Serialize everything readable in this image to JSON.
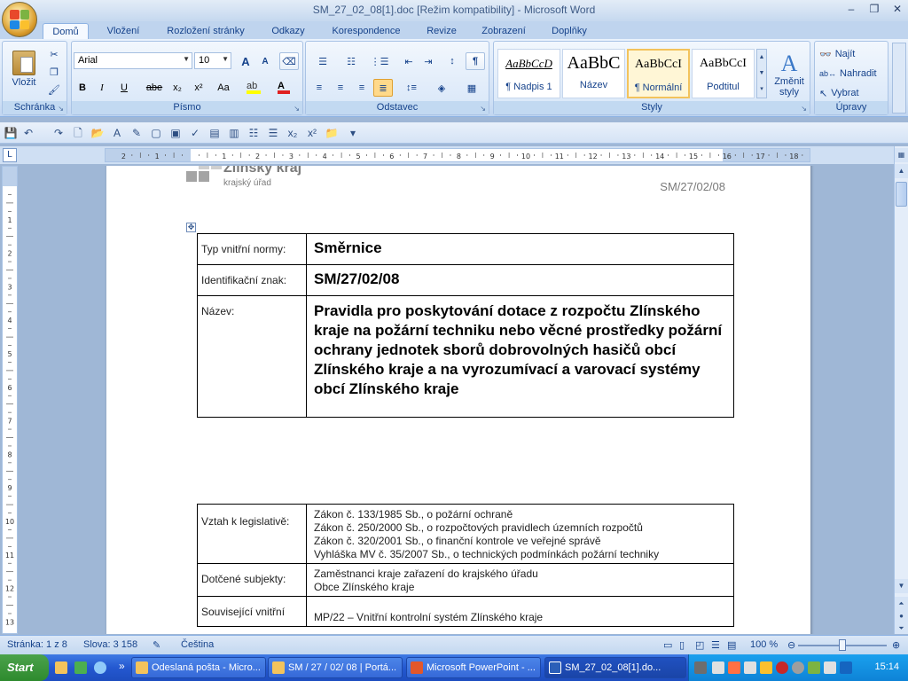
{
  "window": {
    "title": "SM_27_02_08[1].doc [Režim kompatibility] - Microsoft Word",
    "minimize": "–",
    "maximize": "❐",
    "close": "✕"
  },
  "tabs": [
    "Domů",
    "Vložení",
    "Rozložení stránky",
    "Odkazy",
    "Korespondence",
    "Revize",
    "Zobrazení",
    "Doplňky"
  ],
  "ribbon": {
    "groups": {
      "clipboard": "Schránka",
      "font": "Písmo",
      "paragraph": "Odstavec",
      "styles": "Styly",
      "editing": "Úpravy"
    },
    "paste_label": "Vložit",
    "font_name": "Arial",
    "font_size": "10",
    "styles": [
      {
        "sample": "AaBbCcD",
        "name": "¶ Nadpis 1"
      },
      {
        "sample": "AaBbC",
        "name": "Název"
      },
      {
        "sample": "AaBbCcI",
        "name": "¶ Normální"
      },
      {
        "sample": "AaBbCcI",
        "name": "Podtitul"
      }
    ],
    "change_styles_1": "Změnit",
    "change_styles_2": "styly",
    "find": "Najít",
    "replace": "Nahradit",
    "select": "Vybrat",
    "bold": "B",
    "italic": "I",
    "underline": "U",
    "strike": "abe",
    "sub": "x₂",
    "sup": "x²",
    "case": "Aa",
    "grow": "A",
    "shrink": "A",
    "pilcrow": "¶"
  },
  "document": {
    "logo_text": "Zlínský kraj",
    "logo_sub": "krajský úřad",
    "ref": "SM/27/02/08",
    "rows1": [
      {
        "label": "Typ vnitřní normy:",
        "value": "Směrnice"
      },
      {
        "label": "Identifikační znak:",
        "value": "SM/27/02/08"
      },
      {
        "label": "Název:",
        "value": "Pravidla pro poskytování dotace z rozpočtu Zlínského kraje na požární techniku nebo věcné prostředky požární ochrany jednotek sborů dobrovolných hasičů obcí Zlínského kraje a na vyrozumívací a varovací systémy obcí Zlínského kraje"
      }
    ],
    "rows2": [
      {
        "label": "Vztah k legislativě:",
        "lines": [
          "Zákon č. 133/1985 Sb., o požární ochraně",
          "Zákon č. 250/2000 Sb., o rozpočtových pravidlech územních rozpočtů",
          "Zákon č. 320/2001 Sb., o finanční kontrole ve veřejné správě",
          "Vyhláška MV č. 35/2007 Sb., o technických podmínkách požární techniky"
        ]
      },
      {
        "label": "Dotčené subjekty:",
        "lines": [
          "Zaměstnanci kraje zařazení do krajského úřadu",
          "Obce Zlínského kraje"
        ]
      },
      {
        "label": "Související vnitřní",
        "lines": [
          "MP/22 – Vnitřní kontrolní systém Zlínského kraje"
        ]
      }
    ]
  },
  "status": {
    "page": "Stránka: 1 z 8",
    "words": "Slova: 3 158",
    "language": "Čeština",
    "zoom": "100 %"
  },
  "taskbar": {
    "start": "Start",
    "buttons": [
      "Odeslaná pošta - Micro...",
      "SM / 27 / 02/ 08 | Portá...",
      "Microsoft PowerPoint - ...",
      "SM_27_02_08[1].do..."
    ],
    "clock": "15:14"
  },
  "colors": {
    "ribbon": "#cfe0f5",
    "accent": "#15428b",
    "taskbar": "#2458d0"
  }
}
